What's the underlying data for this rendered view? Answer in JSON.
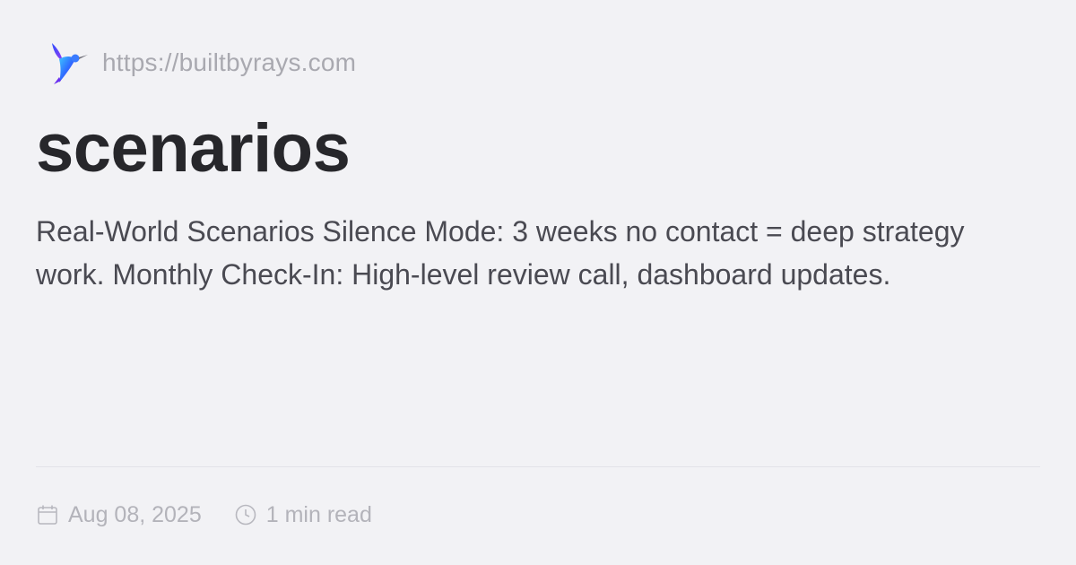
{
  "site": {
    "url": "https://builtbyrays.com",
    "logo_icon": "hummingbird-icon"
  },
  "post": {
    "title": "scenarios",
    "description": "Real-World Scenarios Silence Mode: 3 weeks no contact = deep strategy work. Monthly Check-In: High-level review call, dashboard updates."
  },
  "meta": {
    "date": "Aug 08, 2025",
    "date_icon": "calendar-icon",
    "read_time": "1 min read",
    "read_time_icon": "clock-icon"
  },
  "colors": {
    "background": "#f2f2f5",
    "title": "#27272b",
    "description": "#4a4a52",
    "muted": "#a9a9b0",
    "logo_blue": "#2f6bff",
    "logo_purple": "#7b2ff7"
  }
}
